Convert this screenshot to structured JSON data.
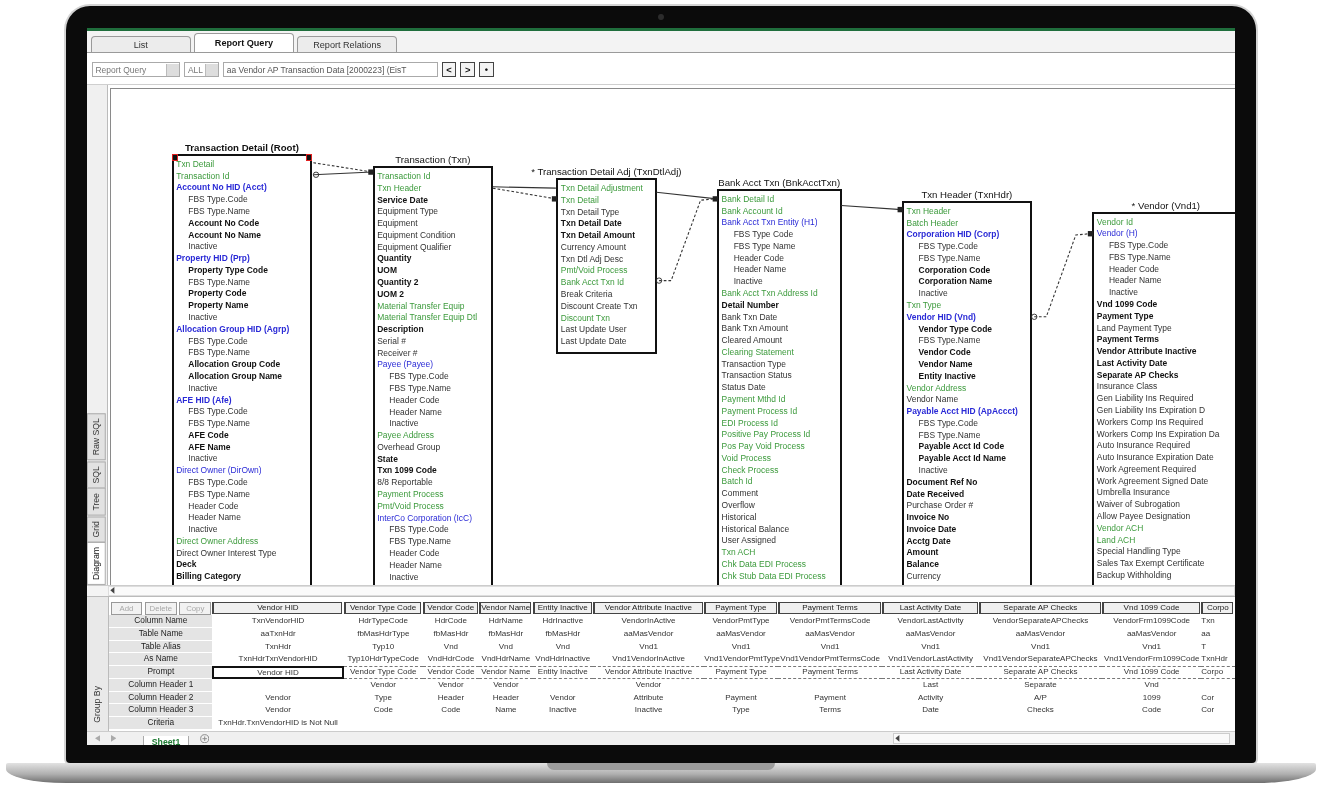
{
  "tabs": [
    {
      "label": "List",
      "selected": false
    },
    {
      "label": "Report Query",
      "selected": true
    },
    {
      "label": "Report Relations",
      "selected": false
    }
  ],
  "toolbar": {
    "view_select": "Report Query",
    "filter_select": "ALL",
    "report_field": "aa Vendor AP Transaction Data [2000223] (EisT",
    "buttons": [
      "<",
      ">",
      "•"
    ]
  },
  "side_tabs": [
    {
      "label": "Raw SQL",
      "selected": false
    },
    {
      "label": "SQL",
      "selected": false
    },
    {
      "label": "Tree",
      "selected": false
    },
    {
      "label": "Grid",
      "selected": false
    },
    {
      "label": "Diagram",
      "selected": true
    }
  ],
  "diagram": {
    "tables": [
      {
        "title": "Transaction Detail (Root)",
        "selected": true,
        "fields": [
          {
            "text": "Txn Detail",
            "kind": "key"
          },
          {
            "text": "Transaction Id",
            "kind": "key"
          },
          {
            "text": "Account No HID (Acct)",
            "kind": "heading",
            "children": [
              {
                "text": "FBS Type.Code",
                "kind": "plain"
              },
              {
                "text": "FBS Type.Name",
                "kind": "plain"
              },
              {
                "text": "Account No Code",
                "kind": "bold"
              },
              {
                "text": "Account No Name",
                "kind": "bold"
              },
              {
                "text": "Inactive",
                "kind": "plain"
              }
            ]
          },
          {
            "text": "Property HID (Prp)",
            "kind": "heading",
            "children": [
              {
                "text": "Property Type Code",
                "kind": "bold"
              },
              {
                "text": "FBS Type.Name",
                "kind": "plain"
              },
              {
                "text": "Property Code",
                "kind": "bold"
              },
              {
                "text": "Property Name",
                "kind": "bold"
              },
              {
                "text": "Inactive",
                "kind": "plain"
              }
            ]
          },
          {
            "text": "Allocation Group HID (Agrp)",
            "kind": "heading",
            "children": [
              {
                "text": "FBS Type.Code",
                "kind": "plain"
              },
              {
                "text": "FBS Type.Name",
                "kind": "plain"
              },
              {
                "text": "Allocation Group Code",
                "kind": "bold"
              },
              {
                "text": "Allocation Group Name",
                "kind": "bold"
              },
              {
                "text": "Inactive",
                "kind": "plain"
              }
            ]
          },
          {
            "text": "AFE HID (Afe)",
            "kind": "heading",
            "children": [
              {
                "text": "FBS Type.Code",
                "kind": "plain"
              },
              {
                "text": "FBS Type.Name",
                "kind": "plain"
              },
              {
                "text": "AFE Code",
                "kind": "bold"
              },
              {
                "text": "AFE Name",
                "kind": "bold"
              },
              {
                "text": "Inactive",
                "kind": "plain"
              }
            ]
          },
          {
            "text": "Direct Owner (DirOwn)",
            "kind": "link",
            "children": [
              {
                "text": "FBS Type.Code",
                "kind": "plain"
              },
              {
                "text": "FBS Type.Name",
                "kind": "plain"
              },
              {
                "text": "Header Code",
                "kind": "plain"
              },
              {
                "text": "Header Name",
                "kind": "plain"
              },
              {
                "text": "Inactive",
                "kind": "plain"
              }
            ]
          },
          {
            "text": "Direct Owner Address",
            "kind": "key"
          },
          {
            "text": "Direct Owner Interest Type",
            "kind": "plain"
          },
          {
            "text": "Deck",
            "kind": "bold"
          },
          {
            "text": "Billing Category",
            "kind": "bold"
          }
        ]
      },
      {
        "title": "Transaction (Txn)",
        "selected": false,
        "fields": [
          {
            "text": "Transaction Id",
            "kind": "key"
          },
          {
            "text": "Txn Header",
            "kind": "key"
          },
          {
            "text": "Service Date",
            "kind": "bold"
          },
          {
            "text": "Equipment Type",
            "kind": "plain"
          },
          {
            "text": "Equipment",
            "kind": "plain"
          },
          {
            "text": "Equipment Condition",
            "kind": "plain"
          },
          {
            "text": "Equipment Qualifier",
            "kind": "plain"
          },
          {
            "text": "Quantity",
            "kind": "bold"
          },
          {
            "text": "UOM",
            "kind": "bold"
          },
          {
            "text": "Quantity 2",
            "kind": "bold"
          },
          {
            "text": "UOM 2",
            "kind": "bold"
          },
          {
            "text": "Material Transfer Equip",
            "kind": "key"
          },
          {
            "text": "Material Transfer Equip Dtl",
            "kind": "key"
          },
          {
            "text": "Description",
            "kind": "bold"
          },
          {
            "text": "Serial #",
            "kind": "plain"
          },
          {
            "text": "Receiver #",
            "kind": "plain"
          },
          {
            "text": "Payee (Payee)",
            "kind": "link",
            "children": [
              {
                "text": "FBS Type.Code",
                "kind": "plain"
              },
              {
                "text": "FBS Type.Name",
                "kind": "plain"
              },
              {
                "text": "Header Code",
                "kind": "plain"
              },
              {
                "text": "Header Name",
                "kind": "plain"
              },
              {
                "text": "Inactive",
                "kind": "plain"
              }
            ]
          },
          {
            "text": "Payee Address",
            "kind": "key"
          },
          {
            "text": "Overhead Group",
            "kind": "plain"
          },
          {
            "text": "State",
            "kind": "bold"
          },
          {
            "text": "Txn 1099 Code",
            "kind": "bold"
          },
          {
            "text": "8/8 Reportable",
            "kind": "plain"
          },
          {
            "text": "Payment Process",
            "kind": "key"
          },
          {
            "text": "Pmt/Void Process",
            "kind": "key"
          },
          {
            "text": "InterCo Corporation (IcC)",
            "kind": "link",
            "children": [
              {
                "text": "FBS Type.Code",
                "kind": "plain"
              },
              {
                "text": "FBS Type.Name",
                "kind": "plain"
              },
              {
                "text": "Header Code",
                "kind": "plain"
              },
              {
                "text": "Header Name",
                "kind": "plain"
              },
              {
                "text": "Inactive",
                "kind": "plain"
              }
            ]
          }
        ]
      },
      {
        "title": "* Transaction Detail Adj (TxnDtlAdj)",
        "selected": false,
        "fields": [
          {
            "text": "Txn Detail Adjustment",
            "kind": "key"
          },
          {
            "text": "Txn Detail",
            "kind": "key"
          },
          {
            "text": "Txn Detail Type",
            "kind": "plain"
          },
          {
            "text": "Txn Detail Date",
            "kind": "bold"
          },
          {
            "text": "Txn Detail Amount",
            "kind": "bold"
          },
          {
            "text": "Currency Amount",
            "kind": "plain"
          },
          {
            "text": "Txn Dtl Adj Desc",
            "kind": "plain"
          },
          {
            "text": "Pmt/Void Process",
            "kind": "key"
          },
          {
            "text": "Bank Acct Txn Id",
            "kind": "key"
          },
          {
            "text": "Break Criteria",
            "kind": "plain"
          },
          {
            "text": "Discount Create Txn",
            "kind": "plain"
          },
          {
            "text": "Discount Txn",
            "kind": "key"
          },
          {
            "text": "Last Update User",
            "kind": "plain"
          },
          {
            "text": "Last Update Date",
            "kind": "plain"
          }
        ]
      },
      {
        "title": "Bank Acct Txn (BnkAcctTxn)",
        "selected": false,
        "fields": [
          {
            "text": "Bank Detail Id",
            "kind": "key"
          },
          {
            "text": "Bank Account Id",
            "kind": "key"
          },
          {
            "text": "Bank Acct Txn Entity (H1)",
            "kind": "link",
            "children": [
              {
                "text": "FBS Type Code",
                "kind": "plain"
              },
              {
                "text": "FBS Type Name",
                "kind": "plain"
              },
              {
                "text": "Header Code",
                "kind": "plain"
              },
              {
                "text": "Header Name",
                "kind": "plain"
              },
              {
                "text": "Inactive",
                "kind": "plain"
              }
            ]
          },
          {
            "text": "Bank Acct Txn Address Id",
            "kind": "key"
          },
          {
            "text": "Detail Number",
            "kind": "bold"
          },
          {
            "text": "Bank Txn Date",
            "kind": "plain"
          },
          {
            "text": "Bank Txn Amount",
            "kind": "plain"
          },
          {
            "text": "Cleared Amount",
            "kind": "plain"
          },
          {
            "text": "Clearing Statement",
            "kind": "key"
          },
          {
            "text": "Transaction Type",
            "kind": "plain"
          },
          {
            "text": "Transaction Status",
            "kind": "plain"
          },
          {
            "text": "Status Date",
            "kind": "plain"
          },
          {
            "text": "Payment Mthd Id",
            "kind": "key"
          },
          {
            "text": "Payment Process Id",
            "kind": "key"
          },
          {
            "text": "EDI Process Id",
            "kind": "key"
          },
          {
            "text": "Positive Pay Process Id",
            "kind": "key"
          },
          {
            "text": "Pos Pay Void Process",
            "kind": "key"
          },
          {
            "text": "Void Process",
            "kind": "key"
          },
          {
            "text": "Check Process",
            "kind": "key"
          },
          {
            "text": "Batch Id",
            "kind": "key"
          },
          {
            "text": "Comment",
            "kind": "plain"
          },
          {
            "text": "Overflow",
            "kind": "plain"
          },
          {
            "text": "Historical",
            "kind": "plain"
          },
          {
            "text": "Historical Balance",
            "kind": "plain"
          },
          {
            "text": "User Assigned",
            "kind": "plain"
          },
          {
            "text": "Txn ACH",
            "kind": "key"
          },
          {
            "text": "Chk Data EDI Process",
            "kind": "key"
          },
          {
            "text": "Chk Stub Data EDI Process",
            "kind": "key"
          }
        ]
      },
      {
        "title": "Txn Header (TxnHdr)",
        "selected": false,
        "fields": [
          {
            "text": "Txn Header",
            "kind": "key"
          },
          {
            "text": "Batch Header",
            "kind": "key"
          },
          {
            "text": "Corporation HID (Corp)",
            "kind": "heading",
            "children": [
              {
                "text": "FBS Type.Code",
                "kind": "plain"
              },
              {
                "text": "FBS Type.Name",
                "kind": "plain"
              },
              {
                "text": "Corporation Code",
                "kind": "bold"
              },
              {
                "text": "Corporation Name",
                "kind": "bold"
              },
              {
                "text": "Inactive",
                "kind": "plain"
              }
            ]
          },
          {
            "text": "Txn Type",
            "kind": "key"
          },
          {
            "text": "Vendor HID (Vnd)",
            "kind": "heading",
            "children": [
              {
                "text": "Vendor Type Code",
                "kind": "bold"
              },
              {
                "text": "FBS Type.Name",
                "kind": "plain"
              },
              {
                "text": "Vendor Code",
                "kind": "bold"
              },
              {
                "text": "Vendor Name",
                "kind": "bold"
              },
              {
                "text": "Entity Inactive",
                "kind": "bold"
              }
            ]
          },
          {
            "text": "Vendor Address",
            "kind": "key"
          },
          {
            "text": "Vendor Name",
            "kind": "plain"
          },
          {
            "text": "Payable Acct HID (ApAccct)",
            "kind": "heading",
            "children": [
              {
                "text": "FBS Type.Code",
                "kind": "plain"
              },
              {
                "text": "FBS Type.Name",
                "kind": "plain"
              },
              {
                "text": "Payable Acct Id Code",
                "kind": "bold"
              },
              {
                "text": "Payable Acct Id Name",
                "kind": "bold"
              },
              {
                "text": "Inactive",
                "kind": "plain"
              }
            ]
          },
          {
            "text": "Document Ref No",
            "kind": "bold"
          },
          {
            "text": "Date Received",
            "kind": "bold"
          },
          {
            "text": "Purchase Order #",
            "kind": "plain"
          },
          {
            "text": "Invoice No",
            "kind": "bold"
          },
          {
            "text": "Invoice Date",
            "kind": "bold"
          },
          {
            "text": "Acctg Date",
            "kind": "bold"
          },
          {
            "text": "Amount",
            "kind": "bold"
          },
          {
            "text": "Balance",
            "kind": "bold"
          },
          {
            "text": "Currency",
            "kind": "plain"
          }
        ]
      },
      {
        "title": "* Vendor (Vnd1)",
        "selected": false,
        "fields": [
          {
            "text": "Vendor Id",
            "kind": "key"
          },
          {
            "text": "Vendor (H)",
            "kind": "link",
            "children": [
              {
                "text": "FBS Type.Code",
                "kind": "plain"
              },
              {
                "text": "FBS Type.Name",
                "kind": "plain"
              },
              {
                "text": "Header Code",
                "kind": "plain"
              },
              {
                "text": "Header Name",
                "kind": "plain"
              },
              {
                "text": "Inactive",
                "kind": "plain"
              }
            ]
          },
          {
            "text": "Vnd 1099 Code",
            "kind": "bold"
          },
          {
            "text": "Payment Type",
            "kind": "bold"
          },
          {
            "text": "Land Payment Type",
            "kind": "plain"
          },
          {
            "text": "Payment Terms",
            "kind": "bold"
          },
          {
            "text": "Vendor Attribute Inactive",
            "kind": "bold"
          },
          {
            "text": "Last Activity Date",
            "kind": "bold"
          },
          {
            "text": "Separate AP Checks",
            "kind": "bold"
          },
          {
            "text": "Insurance Class",
            "kind": "plain"
          },
          {
            "text": "Gen Liability Ins Required",
            "kind": "plain"
          },
          {
            "text": "Gen Liability Ins Expiration D",
            "kind": "plain"
          },
          {
            "text": "Workers Comp Ins Required",
            "kind": "plain"
          },
          {
            "text": "Workers Comp Ins Expiration Da",
            "kind": "plain"
          },
          {
            "text": "Auto Insurance Required",
            "kind": "plain"
          },
          {
            "text": "Auto Insurance Expiration Date",
            "kind": "plain"
          },
          {
            "text": "Work Agreement Required",
            "kind": "plain"
          },
          {
            "text": "Work Agreement Signed Date",
            "kind": "plain"
          },
          {
            "text": "Umbrella Insurance",
            "kind": "plain"
          },
          {
            "text": "Waiver of Subrogation",
            "kind": "plain"
          },
          {
            "text": "Allow Payee Designation",
            "kind": "plain"
          },
          {
            "text": "Vendor ACH",
            "kind": "key"
          },
          {
            "text": "Land ACH",
            "kind": "key"
          },
          {
            "text": "Special Handling Type",
            "kind": "plain"
          },
          {
            "text": "Sales Tax Exempt Certificate",
            "kind": "plain"
          },
          {
            "text": "Backup Withholding",
            "kind": "plain"
          }
        ]
      }
    ]
  },
  "grid": {
    "actions": [
      {
        "label": "Add",
        "disabled": true
      },
      {
        "label": "Delete",
        "disabled": true
      },
      {
        "label": "Copy",
        "disabled": true
      }
    ],
    "group_label": "Group By",
    "row_labels": [
      "Column Name",
      "Table Name",
      "Table Alias",
      "As Name",
      "Prompt",
      "Column Header 1",
      "Column Header 2",
      "Column Header 3",
      "Criteria"
    ],
    "columns": [
      {
        "header": "Vendor HID",
        "selected": true,
        "cells": [
          "TxnVendorHID",
          "aaTxnHdr",
          "TxnHdr",
          "TxnHdrTxnVendorHID",
          "Vendor HID",
          null,
          "Vendor",
          "Vendor",
          "TxnHdr.TxnVendorHID is Not Null"
        ]
      },
      {
        "header": "Vendor Type Code",
        "selected": false,
        "cells": [
          "HdrTypeCode",
          "fbMasHdrType",
          "Typ10",
          "Typ10HdrTypeCode",
          "Vendor Type Code",
          "Vendor",
          "Type",
          "Code",
          null
        ]
      },
      {
        "header": "Vendor Code",
        "selected": false,
        "cells": [
          "HdrCode",
          "fbMasHdr",
          "Vnd",
          "VndHdrCode",
          "Vendor Code",
          "Vendor",
          "Header",
          "Code",
          null
        ]
      },
      {
        "header": "Vendor Name",
        "selected": false,
        "cells": [
          "HdrName",
          "fbMasHdr",
          "Vnd",
          "VndHdrName",
          "Vendor Name",
          "Vendor",
          "Header",
          "Name",
          null
        ]
      },
      {
        "header": "Entity Inactive",
        "selected": false,
        "cells": [
          "HdrInactive",
          "fbMasHdr",
          "Vnd",
          "VndHdrInactive",
          "Entity Inactive",
          null,
          "Vendor",
          "Inactive",
          null
        ]
      },
      {
        "header": "Vendor Attribute Inactive",
        "selected": false,
        "cells": [
          "VendorInActive",
          "aaMasVendor",
          "Vnd1",
          "Vnd1VendorInActive",
          "Vendor Attribute Inactive",
          "Vendor",
          "Attribute",
          "Inactive",
          null
        ]
      },
      {
        "header": "Payment Type",
        "selected": false,
        "cells": [
          "VendorPmtType",
          "aaMasVendor",
          "Vnd1",
          "Vnd1VendorPmtType",
          "Payment Type",
          null,
          "Payment",
          "Type",
          null
        ]
      },
      {
        "header": "Payment Terms",
        "selected": false,
        "cells": [
          "VendorPmtTermsCode",
          "aaMasVendor",
          "Vnd1",
          "Vnd1VendorPmtTermsCode",
          "Payment Terms",
          null,
          "Payment",
          "Terms",
          null
        ]
      },
      {
        "header": "Last Activity Date",
        "selected": false,
        "cells": [
          "VendorLastActivity",
          "aaMasVendor",
          "Vnd1",
          "Vnd1VendorLastActivity",
          "Last Activity Date",
          "Last",
          "Activity",
          "Date",
          null
        ]
      },
      {
        "header": "Separate AP Checks",
        "selected": false,
        "cells": [
          "VendorSeparateAPChecks",
          "aaMasVendor",
          "Vnd1",
          "Vnd1VendorSeparateAPChecks",
          "Separate AP Checks",
          "Separate",
          "A/P",
          "Checks",
          null
        ]
      },
      {
        "header": "Vnd 1099 Code",
        "selected": false,
        "cells": [
          "VendorFrm1099Code",
          "aaMasVendor",
          "Vnd1",
          "Vnd1VendorFrm1099Code",
          "Vnd 1099 Code",
          "Vnd",
          "1099",
          "Code",
          null
        ]
      },
      {
        "header": "Corpo",
        "selected": false,
        "cells": [
          "Txn",
          "aa",
          "T",
          "TxnHdr",
          "Corpo",
          null,
          "Cor",
          "Cor",
          null
        ]
      }
    ]
  },
  "sheet_tabs": [
    {
      "label": "Sheet1",
      "selected": true
    }
  ]
}
